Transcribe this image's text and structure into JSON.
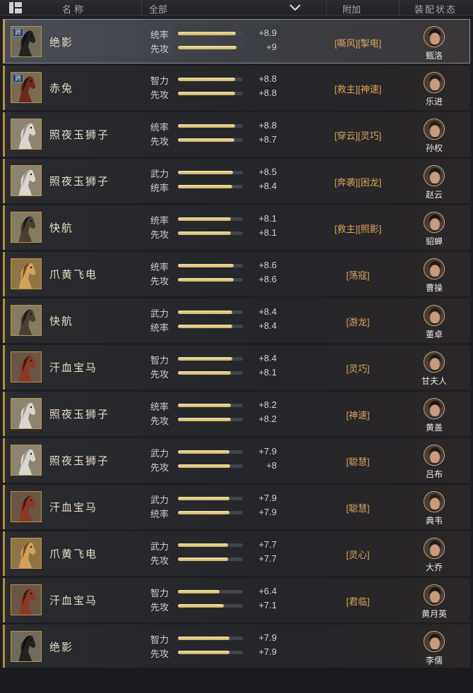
{
  "header": {
    "name_label": "名称",
    "filter_label": "全部",
    "extra_label": "附加",
    "status_label": "装配状态"
  },
  "colors": {
    "accent": "#c89b55",
    "bar": "#e8d48e",
    "tag": "#d9a55a"
  },
  "rows": [
    {
      "name": "绝影",
      "horse": "black",
      "badge": "跨",
      "stats": [
        {
          "label": "统率",
          "value": "+8.9",
          "fill": 0.89
        },
        {
          "label": "先攻",
          "value": "+9",
          "fill": 0.9
        }
      ],
      "tags": "[嘶风][掣电]",
      "general": "甄洛",
      "selected": true
    },
    {
      "name": "赤兔",
      "horse": "red",
      "badge": "跨",
      "stats": [
        {
          "label": "智力",
          "value": "+8.8",
          "fill": 0.88
        },
        {
          "label": "先攻",
          "value": "+8.8",
          "fill": 0.88
        }
      ],
      "tags": "[救主][神速]",
      "general": "乐进"
    },
    {
      "name": "照夜玉狮子",
      "horse": "white",
      "stats": [
        {
          "label": "统率",
          "value": "+8.8",
          "fill": 0.88
        },
        {
          "label": "先攻",
          "value": "+8.7",
          "fill": 0.87
        }
      ],
      "tags": "[穿云][灵巧]",
      "general": "孙权"
    },
    {
      "name": "照夜玉狮子",
      "horse": "white",
      "stats": [
        {
          "label": "武力",
          "value": "+8.5",
          "fill": 0.85
        },
        {
          "label": "统率",
          "value": "+8.4",
          "fill": 0.84
        }
      ],
      "tags": "[奔袭][困龙]",
      "general": "赵云"
    },
    {
      "name": "快航",
      "horse": "dapple",
      "stats": [
        {
          "label": "统率",
          "value": "+8.1",
          "fill": 0.81
        },
        {
          "label": "先攻",
          "value": "+8.1",
          "fill": 0.81
        }
      ],
      "tags": "[救主][照影]",
      "general": "貂蝉"
    },
    {
      "name": "爪黄飞电",
      "horse": "gold",
      "stats": [
        {
          "label": "统率",
          "value": "+8.6",
          "fill": 0.86
        },
        {
          "label": "先攻",
          "value": "+8.6",
          "fill": 0.86
        }
      ],
      "tags": "[荡寇]",
      "general": "曹操"
    },
    {
      "name": "快航",
      "horse": "dapple",
      "stats": [
        {
          "label": "武力",
          "value": "+8.4",
          "fill": 0.84
        },
        {
          "label": "统率",
          "value": "+8.4",
          "fill": 0.84
        }
      ],
      "tags": "[游龙]",
      "general": "董卓"
    },
    {
      "name": "汗血宝马",
      "horse": "chestnut",
      "stats": [
        {
          "label": "智力",
          "value": "+8.4",
          "fill": 0.84
        },
        {
          "label": "先攻",
          "value": "+8.1",
          "fill": 0.81
        }
      ],
      "tags": "[灵巧]",
      "general": "甘夫人"
    },
    {
      "name": "照夜玉狮子",
      "horse": "white",
      "stats": [
        {
          "label": "统率",
          "value": "+8.2",
          "fill": 0.82
        },
        {
          "label": "先攻",
          "value": "+8.2",
          "fill": 0.82
        }
      ],
      "tags": "[神速]",
      "general": "黄盖"
    },
    {
      "name": "照夜玉狮子",
      "horse": "white",
      "stats": [
        {
          "label": "武力",
          "value": "+7.9",
          "fill": 0.79
        },
        {
          "label": "先攻",
          "value": "+8",
          "fill": 0.8
        }
      ],
      "tags": "[聪慧]",
      "general": "吕布"
    },
    {
      "name": "汗血宝马",
      "horse": "chestnut",
      "stats": [
        {
          "label": "武力",
          "value": "+7.9",
          "fill": 0.79
        },
        {
          "label": "统率",
          "value": "+7.9",
          "fill": 0.79
        }
      ],
      "tags": "[聪慧]",
      "general": "典韦"
    },
    {
      "name": "爪黄飞电",
      "horse": "gold",
      "stats": [
        {
          "label": "武力",
          "value": "+7.7",
          "fill": 0.77
        },
        {
          "label": "先攻",
          "value": "+7.7",
          "fill": 0.77
        }
      ],
      "tags": "[灵心]",
      "general": "大乔"
    },
    {
      "name": "汗血宝马",
      "horse": "chestnut",
      "stats": [
        {
          "label": "智力",
          "value": "+6.4",
          "fill": 0.64
        },
        {
          "label": "先攻",
          "value": "+7.1",
          "fill": 0.71
        }
      ],
      "tags": "[君临]",
      "general": "黄月英"
    },
    {
      "name": "绝影",
      "horse": "black",
      "stats": [
        {
          "label": "智力",
          "value": "+7.9",
          "fill": 0.79
        },
        {
          "label": "先攻",
          "value": "+7.9",
          "fill": 0.79
        }
      ],
      "tags": "",
      "general": "李儒"
    }
  ]
}
